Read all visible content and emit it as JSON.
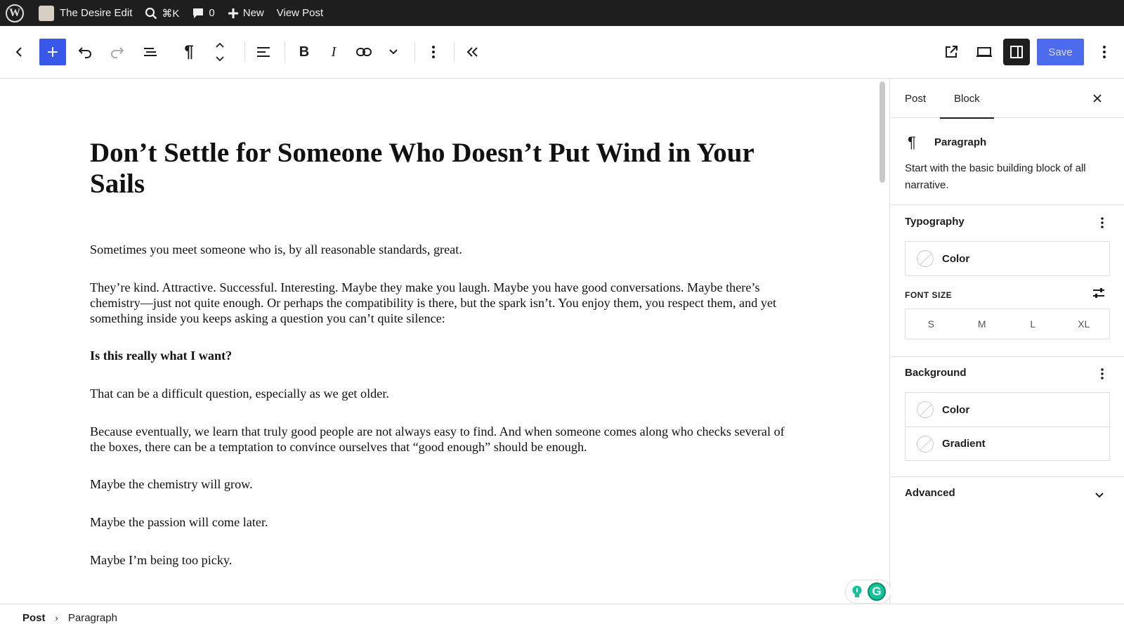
{
  "adminbar": {
    "site_name": "The Desire Edit",
    "search_shortcut": "⌘K",
    "comments_count": "0",
    "new_label": "New",
    "view_post_label": "View Post"
  },
  "toolbar": {
    "save_label": "Save"
  },
  "post": {
    "title": "Don’t Settle for Someone Who Doesn’t Put Wind in Your Sails",
    "paragraphs": [
      "Sometimes you meet someone who is, by all reasonable standards, great.",
      "They’re kind. Attractive. Successful. Interesting. Maybe they make you laugh. Maybe you have good conversations. Maybe there’s chemistry—just not quite enough. Or perhaps the compatibility is there, but the spark isn’t. You enjoy them, you respect them, and yet something inside you keeps asking a question you can’t quite silence:",
      "Is this really what I want?",
      "That can be a difficult question, especially as we get older.",
      "Because eventually, we learn that truly good people are not always easy to find. And when someone comes along who checks several of the boxes, there can be a temptation to convince ourselves that “good enough” should be enough.",
      "Maybe the chemistry will grow.",
      "Maybe the passion will come later.",
      "Maybe I’m being too picky."
    ]
  },
  "sidebar": {
    "tabs": [
      "Post",
      "Block"
    ],
    "active_tab": "Block",
    "block": {
      "name": "Paragraph",
      "description": "Start with the basic building block of all narrative."
    },
    "typography": {
      "title": "Typography",
      "color_label": "Color",
      "font_size_label": "FONT SIZE",
      "sizes": [
        "S",
        "M",
        "L",
        "XL"
      ]
    },
    "background": {
      "title": "Background",
      "color_label": "Color",
      "gradient_label": "Gradient"
    },
    "advanced": {
      "title": "Advanced"
    }
  },
  "footer": {
    "crumb_root": "Post",
    "crumb_current": "Paragraph"
  }
}
